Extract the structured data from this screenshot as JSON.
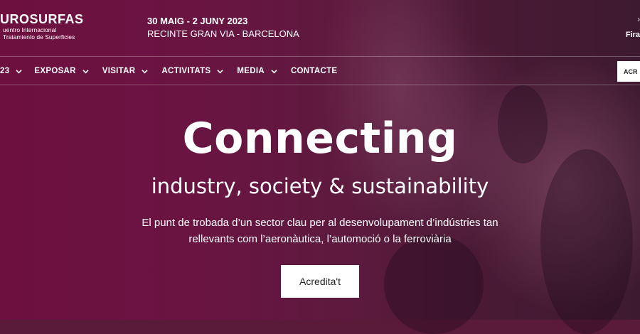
{
  "brand": {
    "name": "UROSURFAS",
    "subtitle_line1": "uentro Internacional",
    "subtitle_line2": "Tratamiento de Superficies"
  },
  "event": {
    "dates": "30 MAIG - 2 JUNY 2023",
    "venue": "RECINTE GRAN VIA - BARCELONA"
  },
  "top_right": {
    "label": "Fira"
  },
  "nav": {
    "items": [
      {
        "label": "23"
      },
      {
        "label": "EXPOSAR"
      },
      {
        "label": "VISITAR"
      },
      {
        "label": "ACTIVITATS"
      },
      {
        "label": "MEDIA"
      },
      {
        "label": "CONTACTE"
      }
    ],
    "button_label": "ACR"
  },
  "hero": {
    "title": "Connecting",
    "subtitle": "industry, society & sustainability",
    "desc_line1": "El punt de trobada d’un sector clau per al desenvolupament d’indústries tan",
    "desc_line2": "rellevants com l’aeronàutica, l’automoció o la ferroviària",
    "cta_label": "Acredita't"
  },
  "colors": {
    "overlay": "#6a1442",
    "text": "#ffffff",
    "button_bg": "#ffffff"
  }
}
